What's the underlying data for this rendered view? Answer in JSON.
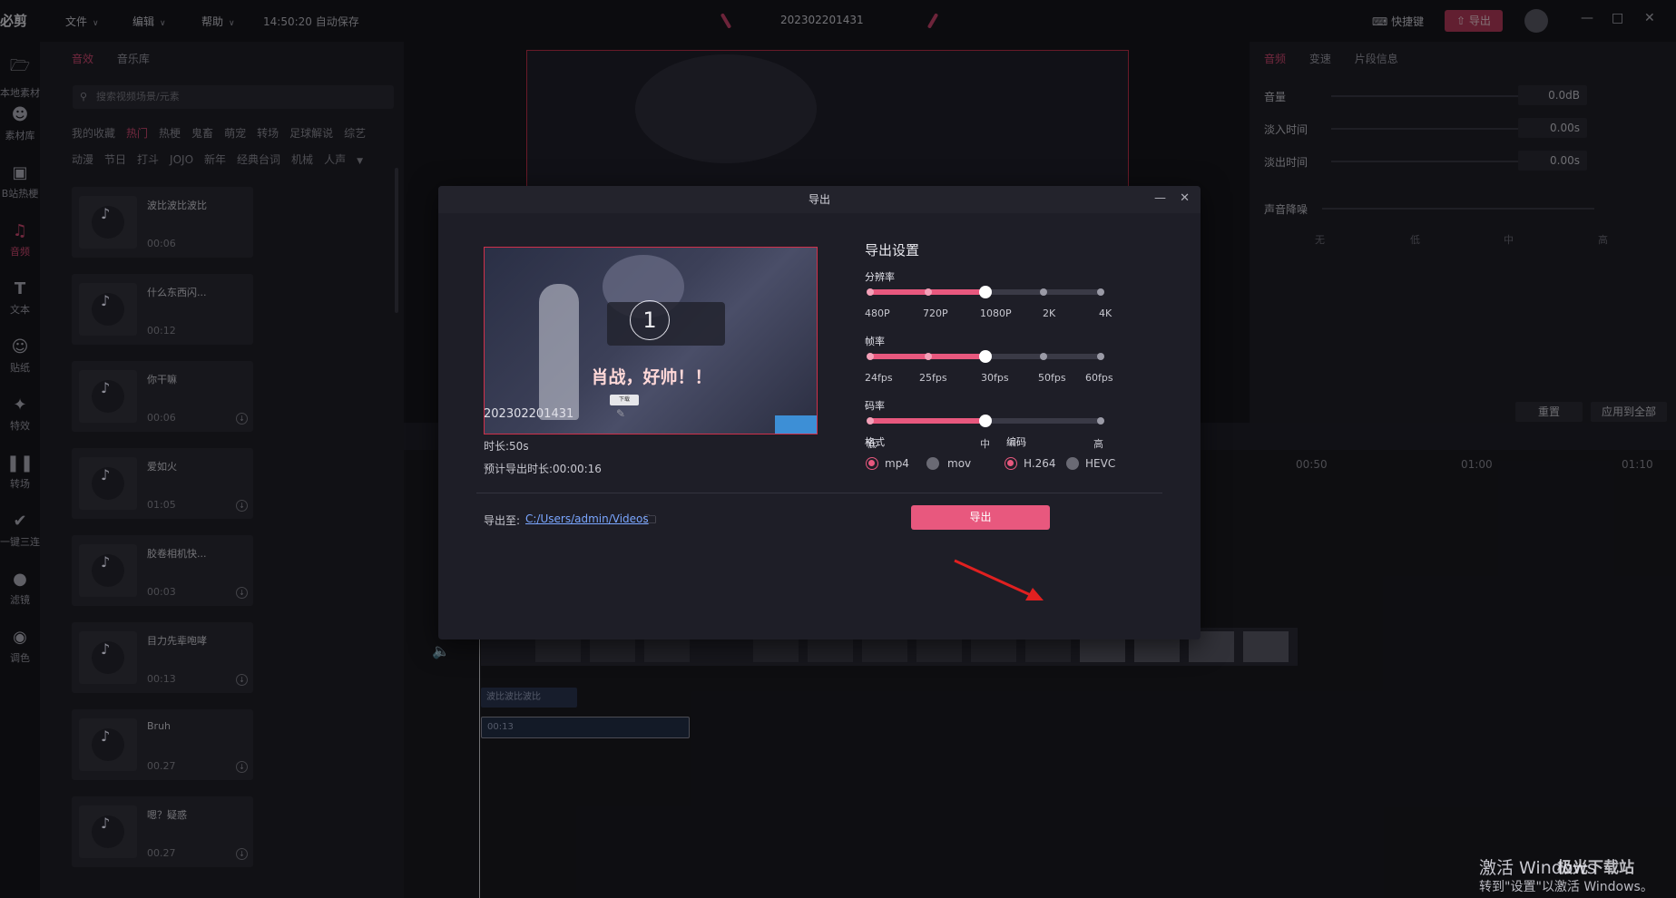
{
  "titlebar": {
    "logo": "必剪",
    "menus": [
      "文件",
      "编辑",
      "帮助"
    ],
    "autosave": "14:50:20 自动保存",
    "project_title": "202302201431",
    "shortcut": "快捷键",
    "export": "导出"
  },
  "rail": [
    "本地素材",
    "素材库",
    "B站热梗",
    "音频",
    "文本",
    "贴纸",
    "特效",
    "转场",
    "一键三连",
    "滤镜",
    "调色"
  ],
  "library": {
    "tabs": [
      "音效",
      "音乐库"
    ],
    "search_placeholder": "搜索视频场景/元素",
    "categories_row1": [
      "我的收藏",
      "热门",
      "热梗",
      "鬼畜",
      "萌宠",
      "转场",
      "足球解说",
      "综艺"
    ],
    "categories_row2": [
      "动漫",
      "节日",
      "打斗",
      "JOJO",
      "新年",
      "经典台词",
      "机械",
      "人声"
    ],
    "items": [
      {
        "name": "波比波比波比",
        "duration": "00:06"
      },
      {
        "name": "什么东西闪...",
        "duration": "00:12"
      },
      {
        "name": "你干嘛",
        "duration": "00:06"
      },
      {
        "name": "爱如火",
        "duration": "01:05"
      },
      {
        "name": "胶卷相机快...",
        "duration": "00:03"
      },
      {
        "name": "目力先辈咆哮",
        "duration": "00:13"
      },
      {
        "name": "Bruh",
        "duration": "00.27"
      },
      {
        "name": "嗯？疑惑",
        "duration": "00.27"
      }
    ]
  },
  "props": {
    "tabs": [
      "音频",
      "变速",
      "片段信息"
    ],
    "volume_label": "音量",
    "volume_value": "0.0dB",
    "fadein_label": "淡入时间",
    "fadein_value": "0.00s",
    "fadeout_label": "淡出时间",
    "fadeout_value": "0.00s",
    "noise_label": "声音降噪",
    "noise_levels": [
      "无",
      "低",
      "中",
      "高"
    ],
    "reset": "重置",
    "apply_all": "应用到全部"
  },
  "timeline": {
    "time_marks": [
      "00:50",
      "01:00",
      "01:10"
    ],
    "clip_a": "波比波比波比",
    "clip_b": "00:13"
  },
  "dialog": {
    "title": "导出",
    "thumb_number": "1",
    "thumb_caption": "肖战，好帅！！",
    "thumb_button": "下载",
    "filename": "202302201431",
    "duration": "时长:50s",
    "estimated": "预计导出时长:00:00:16",
    "settings_title": "导出设置",
    "resolution_label": "分辨率",
    "resolution_options": [
      "480P",
      "720P",
      "1080P",
      "2K",
      "4K"
    ],
    "resolution_selected": 2,
    "fps_label": "帧率",
    "fps_options": [
      "24fps",
      "25fps",
      "30fps",
      "50fps",
      "60fps"
    ],
    "fps_selected": 2,
    "bitrate_label": "码率",
    "bitrate_options": [
      "低",
      "中",
      "高"
    ],
    "bitrate_selected": 1,
    "format_label": "格式",
    "format_options": [
      "mp4",
      "mov"
    ],
    "format_selected": "mp4",
    "codec_label": "编码",
    "codec_options": [
      "H.264",
      "HEVC"
    ],
    "codec_selected": "H.264",
    "export_to_label": "导出至:",
    "export_path": "C:/Users/admin/Videos",
    "export_button": "导出"
  },
  "watermark": {
    "line1": "激活 Windows",
    "line2": "转到\"设置\"以激活 Windows。",
    "site": "极光下载站"
  },
  "colors": {
    "accent": "#e8587e",
    "link": "#7aa6ff",
    "annotation_arrow": "#e02020"
  }
}
